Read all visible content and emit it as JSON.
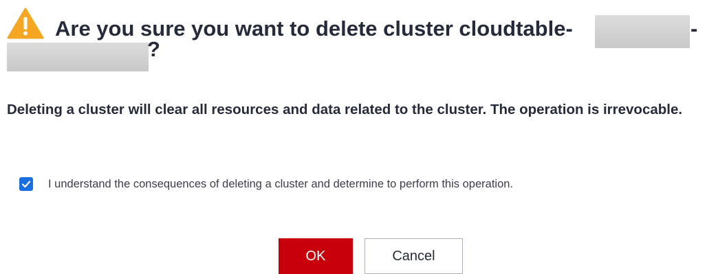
{
  "dialog": {
    "icon": "warning-icon",
    "title_line1": "Are you sure you want to delete cluster cloudtable-",
    "title_tail1": "-",
    "title_tail2": "?",
    "message": "Deleting a cluster will clear all resources and data related to the cluster. The operation is irrevocable.",
    "consent": {
      "checked": true,
      "label": "I understand the consequences of deleting a cluster and determine to perform this operation."
    },
    "buttons": {
      "ok_label": "OK",
      "cancel_label": "Cancel"
    },
    "colors": {
      "warning": "#f5a623",
      "ok_button": "#c7000b",
      "checkbox": "#1a6fe0",
      "text": "#252b3a"
    }
  }
}
